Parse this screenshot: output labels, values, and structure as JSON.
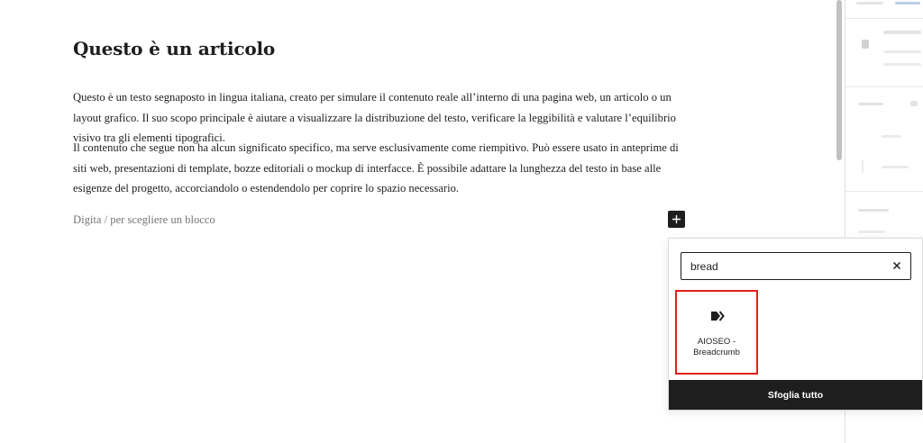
{
  "post": {
    "title": "Questo è un articolo",
    "paragraphs": [
      "Questo è un testo segnaposto in lingua italiana, creato per simulare il contenuto reale all’interno di una pagina web, un articolo o un layout grafico. Il suo scopo principale è aiutare a visualizzare la distribuzione del testo, verificare la leggibilità e valutare l’equilibrio visivo tra gli elementi tipografici.",
      "Il contenuto che segue non ha alcun significato specifico, ma serve esclusivamente come riempitivo. Può essere usato in anteprime di siti web, presentazioni di template, bozze editoriali o mockup di interfacce. È possibile adattare la lunghezza del testo in base alle esigenze del progetto, accorciandolo o estendendolo per coprire lo spazio necessario."
    ],
    "empty_block_placeholder": "Digita / per scegliere un blocco"
  },
  "inserter": {
    "search_value": "bread",
    "results": [
      {
        "label_line1": "AIOSEO -",
        "label_line2": "Breadcrumb",
        "icon": "breadcrumb-arrow-icon"
      }
    ],
    "browse_all_label": "Sfoglia tutto"
  },
  "icons": {
    "add_block": "plus-icon",
    "clear_search": "close-icon"
  },
  "colors": {
    "dark": "#1e1e1e",
    "highlight": "#e0201a",
    "placeholder": "#757575"
  }
}
